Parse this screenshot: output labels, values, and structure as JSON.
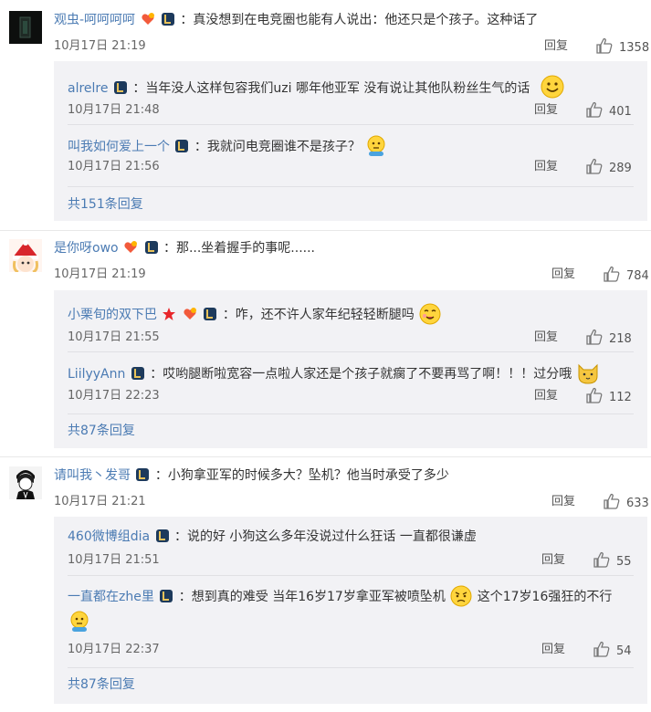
{
  "common": {
    "reply_label": "回复"
  },
  "threads": [
    {
      "user": "观虫-呵呵呵呵",
      "text": "：真没想到在电竞圈也能有人说出：他还只是个孩子。这种话了",
      "time": "10月17日 21:19",
      "likes": "1358",
      "replies": [
        {
          "user": "alrelre",
          "text": "：当年没人这样包容我们uzi  哪年他亚军  没有说让其他队粉丝生气的话",
          "time": "10月17日 21:48",
          "likes": "401"
        },
        {
          "user": "叫我如何爱上一个",
          "text": "：我就问电竞圈谁不是孩子？",
          "time": "10月17日 21:56",
          "likes": "289"
        }
      ],
      "more": "共151条回复"
    },
    {
      "user": "是你呀owo",
      "text": "：那...坐着握手的事呢......",
      "time": "10月17日 21:19",
      "likes": "784",
      "replies": [
        {
          "user": "小栗旬的双下巴",
          "text": "：咋，还不许人家年纪轻轻断腿吗",
          "time": "10月17日 21:55",
          "likes": "218"
        },
        {
          "user": "LiilyyAnn",
          "text": "：哎哟腿断啦宽容一点啦人家还是个孩子就瘸了不要再骂了啊！！！过分哦",
          "time": "10月17日 22:23",
          "likes": "112"
        }
      ],
      "more": "共87条回复"
    },
    {
      "user": "请叫我丶发哥",
      "text": "：小狗拿亚军的时候多大？坠机？他当时承受了多少",
      "time": "10月17日 21:21",
      "likes": "633",
      "replies": [
        {
          "user": "460微博组dia",
          "text": "：说的好 小狗这么多年没说过什么狂话 一直都很谦虚",
          "time": "10月17日 21:51",
          "likes": "55"
        },
        {
          "user": "一直都在zhe里",
          "text": "：想到真的难受 当年16岁17岁拿亚军被喷坠机",
          "text2": "这个17岁16强狂的不行",
          "time": "10月17日 22:37",
          "likes": "54"
        }
      ],
      "more": "共87条回复"
    }
  ]
}
